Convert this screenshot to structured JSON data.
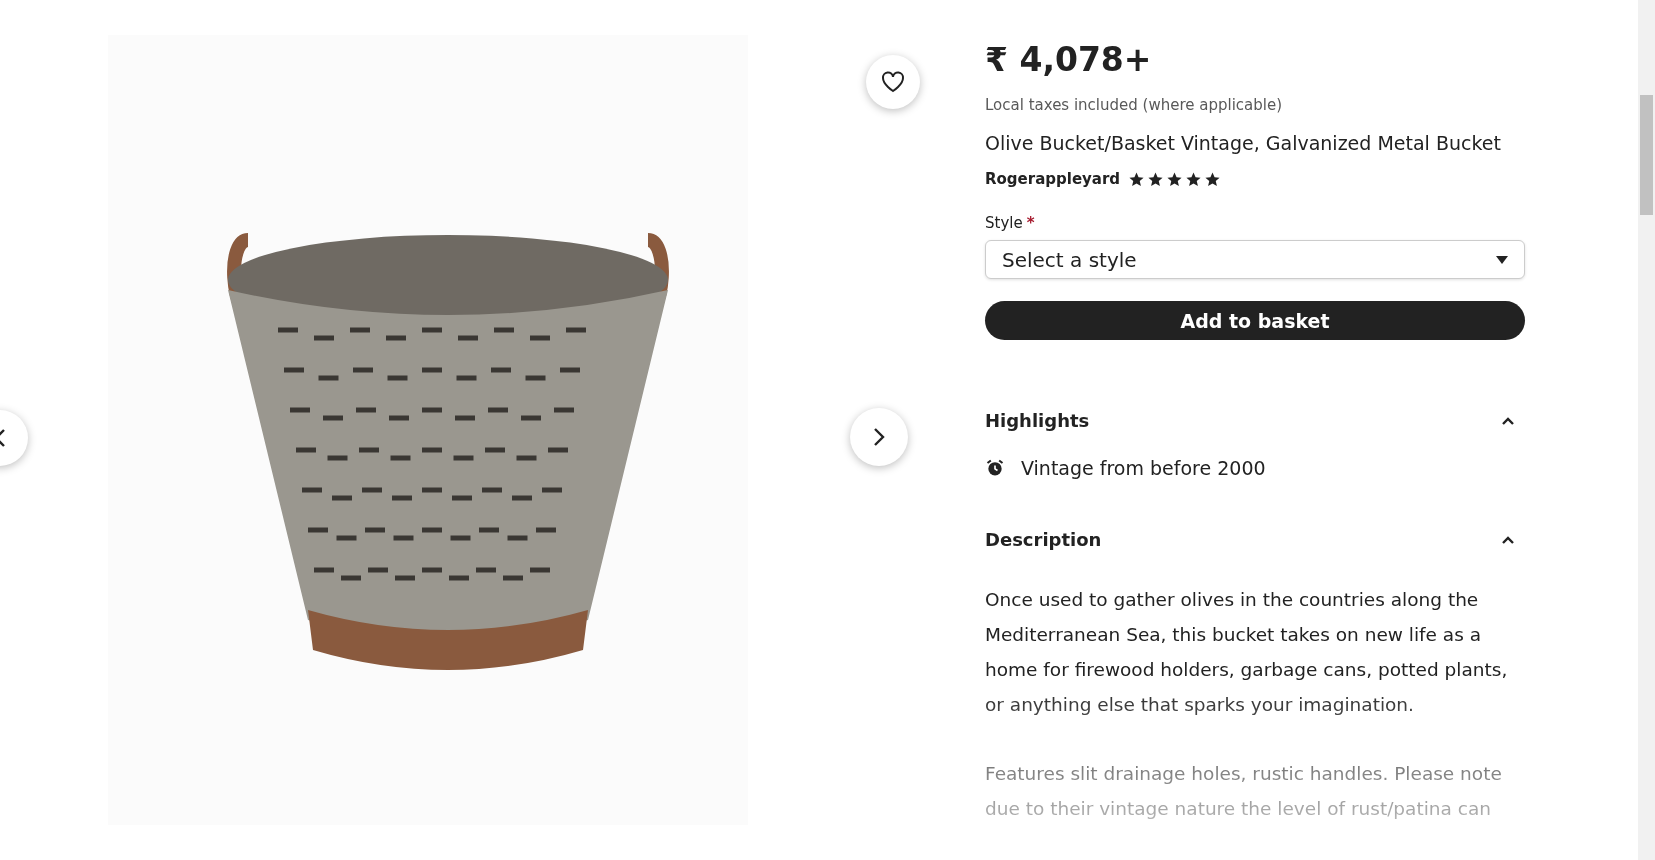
{
  "gallery": {
    "favorited": false
  },
  "listing": {
    "price": "₹ 4,078+",
    "tax_note": "Local taxes included (where applicable)",
    "title": "Olive Bucket/Basket Vintage, Galvanized Metal Bucket",
    "seller": "Rogerappleyard",
    "stars": 5
  },
  "style_field": {
    "label": "Style",
    "required": true,
    "required_mark": "*",
    "placeholder": "Select a style"
  },
  "add_button": "Add to basket",
  "sections": [
    {
      "kind": "highlights",
      "title": "Highlights",
      "expanded": true,
      "items": [
        "Vintage from before 2000"
      ]
    },
    {
      "kind": "description",
      "title": "Description",
      "expanded": true,
      "paragraphs": [
        "Once used to gather olives in the countries along the Mediterranean Sea, this bucket takes on new life as a home for firewood holders, garbage cans, potted plants, or anything else that sparks your imagination.",
        "Features slit drainage holes, rustic handles. Please note due to their vintage nature the level of rust/patina can"
      ]
    }
  ]
}
